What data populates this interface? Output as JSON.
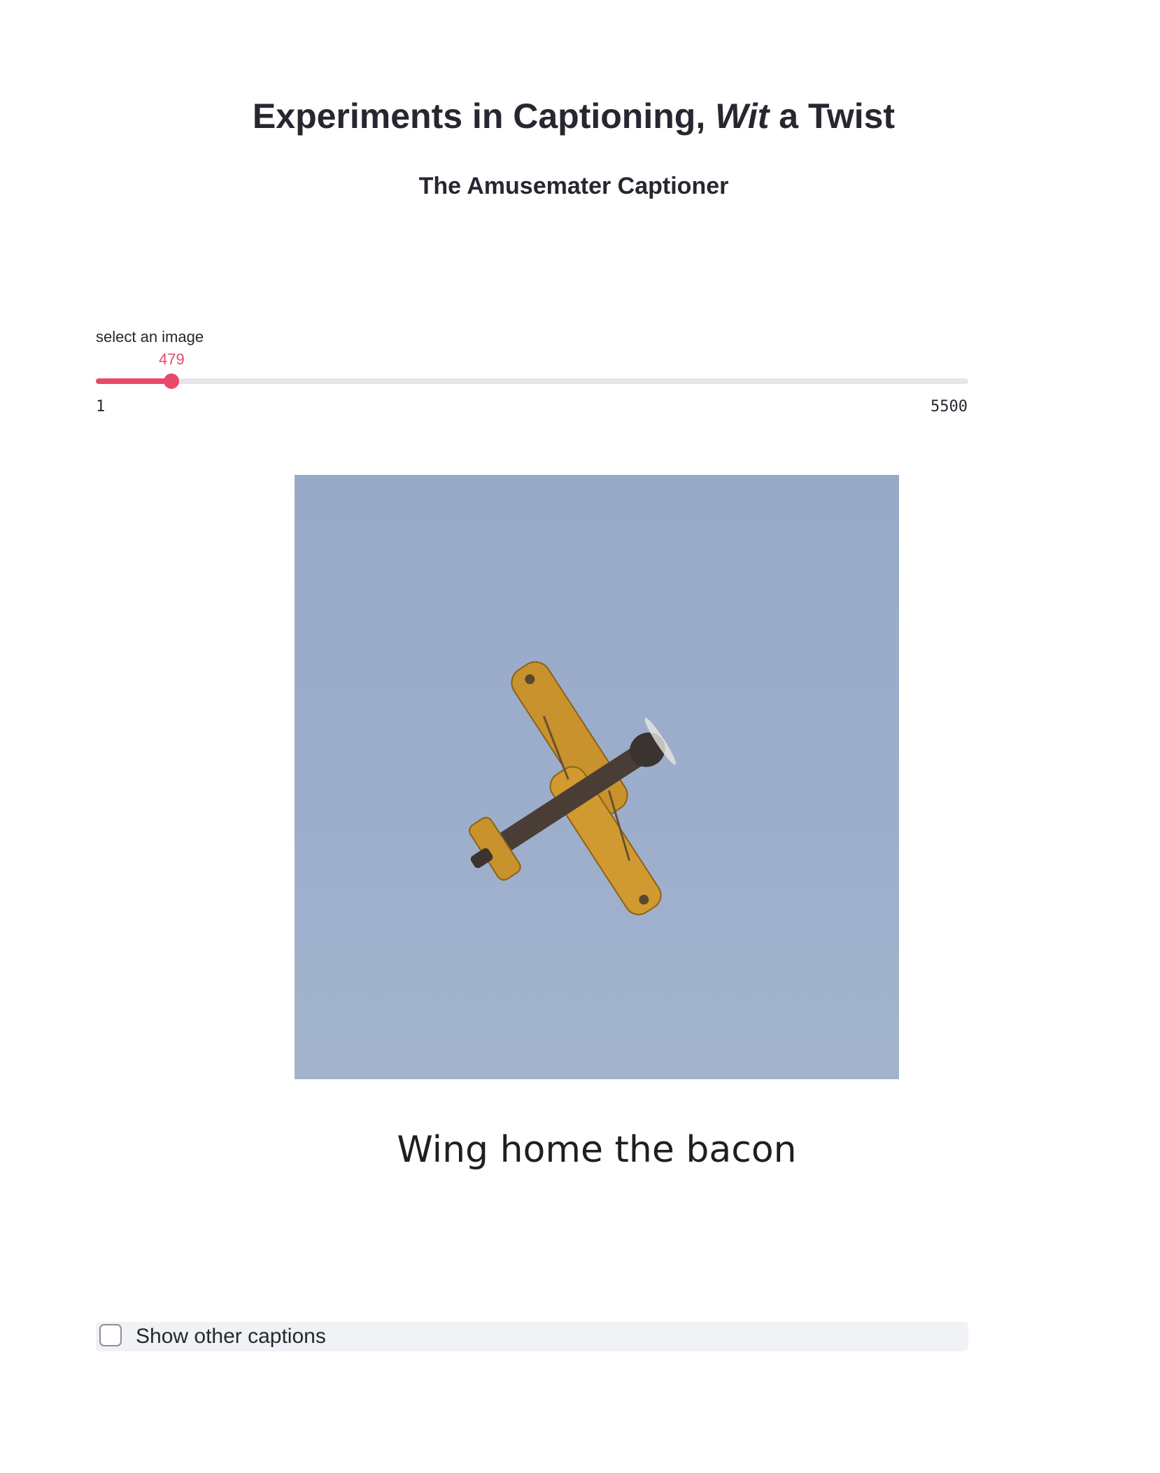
{
  "header": {
    "title_before": "Experiments in Captioning, ",
    "title_italic": "Wit",
    "title_after": " a Twist",
    "subtitle": "The Amusemater Captioner"
  },
  "slider": {
    "label": "select an image",
    "value": 479,
    "min": 1,
    "max": 5500,
    "accent_color": "#e8496a"
  },
  "image": {
    "subject": "yellow-biplane-in-sky"
  },
  "caption": "Wing home the bacon",
  "checkbox": {
    "label": "Show other captions",
    "checked": false
  }
}
